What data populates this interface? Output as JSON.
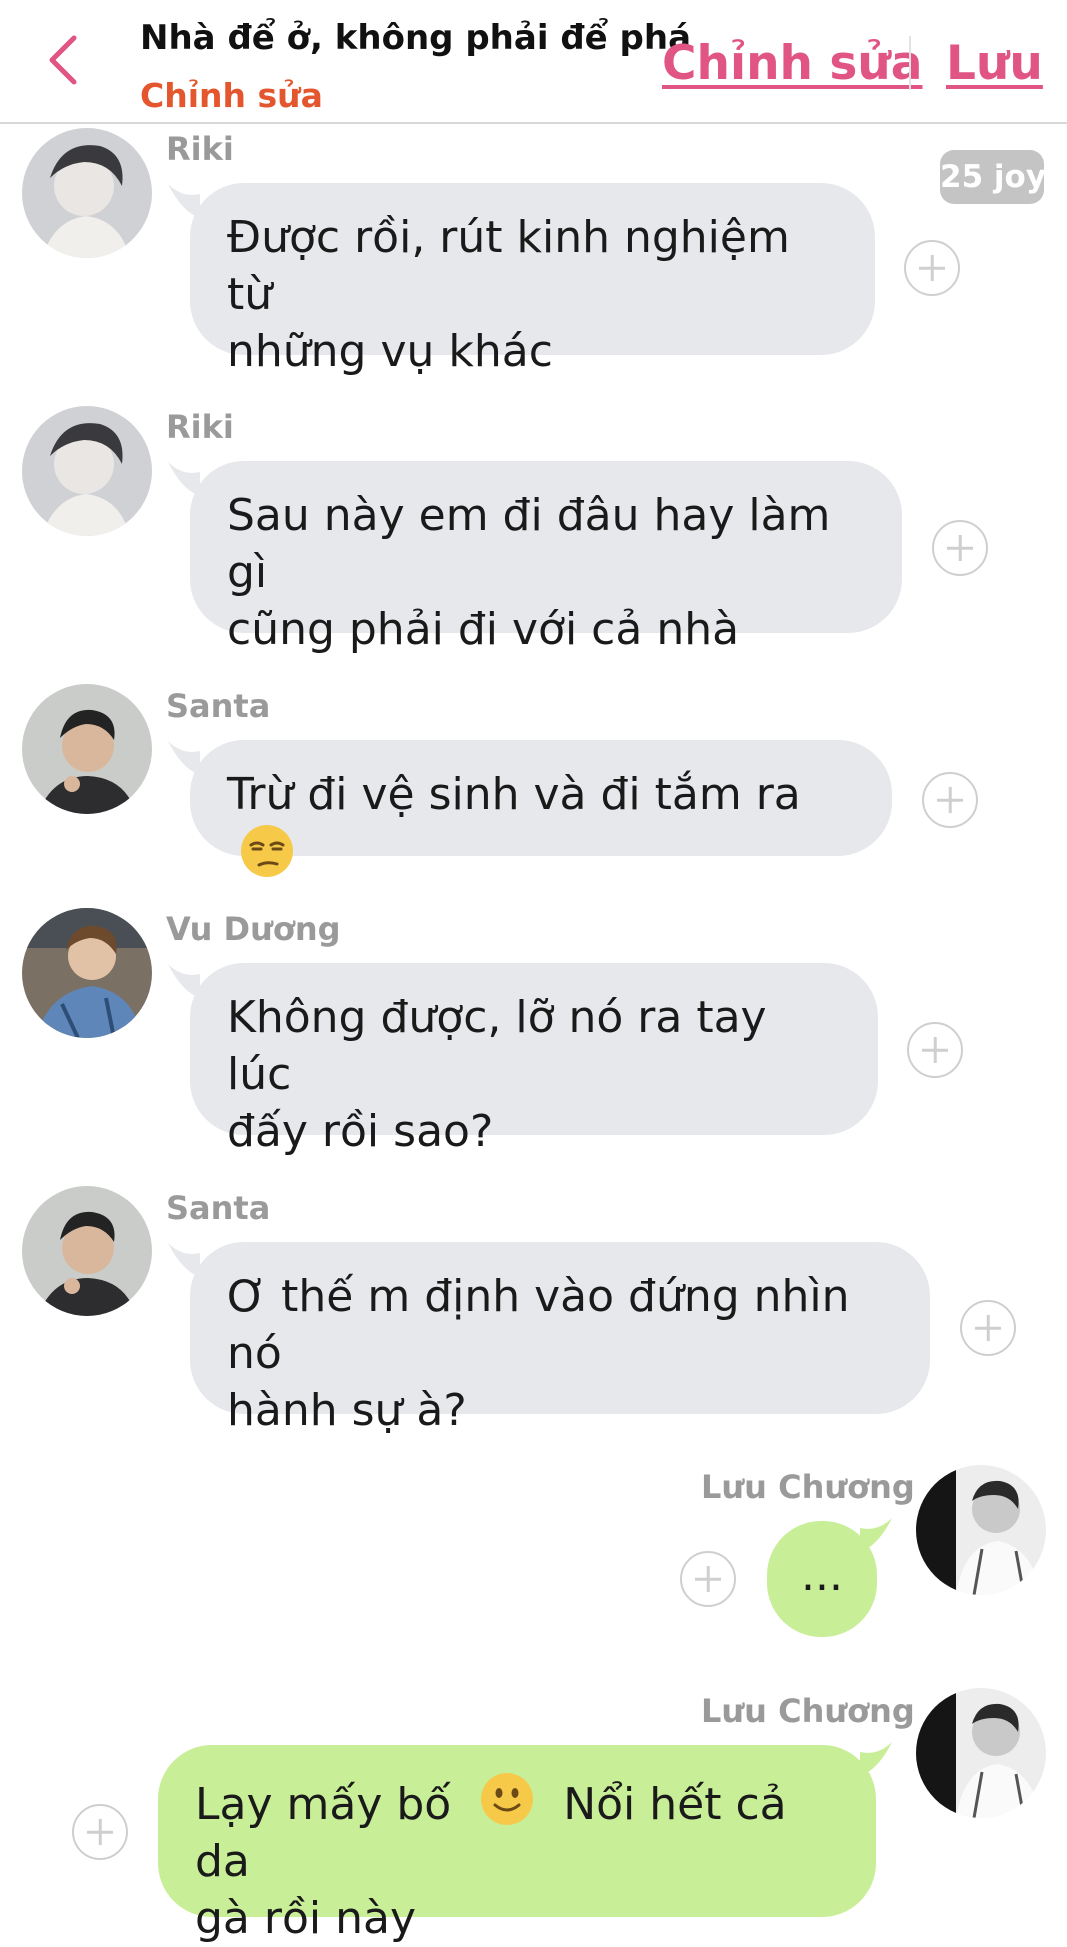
{
  "header": {
    "title": "Nhà để ở, không phải để phá",
    "subtitle": "Chỉnh sửa",
    "edit_label": "Chỉnh sửa",
    "save_label": "Lưu"
  },
  "badge": {
    "label": "25 joy"
  },
  "messages": [
    {
      "sender": "Riki",
      "lines": [
        "Được rồi, rút kinh nghiệm từ",
        "những vụ khác"
      ]
    },
    {
      "sender": "Riki",
      "lines": [
        "Sau này em đi đâu hay làm gì",
        "cũng phải đi với cả nhà"
      ]
    },
    {
      "sender": "Santa",
      "lines": [
        "Trừ đi vệ sinh và đi tắm ra"
      ],
      "emoji": "unamused-face-emoji"
    },
    {
      "sender": "Vu Dương",
      "lines": [
        "Không được, lỡ nó ra tay lúc",
        "đấy rồi sao?"
      ]
    },
    {
      "sender": "Santa",
      "lines": [
        "Ơ thế m định vào đứng nhìn nó",
        "hành sự à?"
      ]
    },
    {
      "sender": "Lưu Chương",
      "lines": [
        "..."
      ]
    },
    {
      "sender": "Lưu Chương",
      "lines": [
        "Lạy mấy bố",
        "Nổi hết cả da",
        "gà rồi này"
      ],
      "emoji": "slight-smile-emoji"
    }
  ],
  "colors": {
    "accent_pink": "#e05583",
    "subtitle_orange": "#e4572e",
    "bubble_gray": "#e6e8ec",
    "bubble_green": "#c8ee98"
  }
}
